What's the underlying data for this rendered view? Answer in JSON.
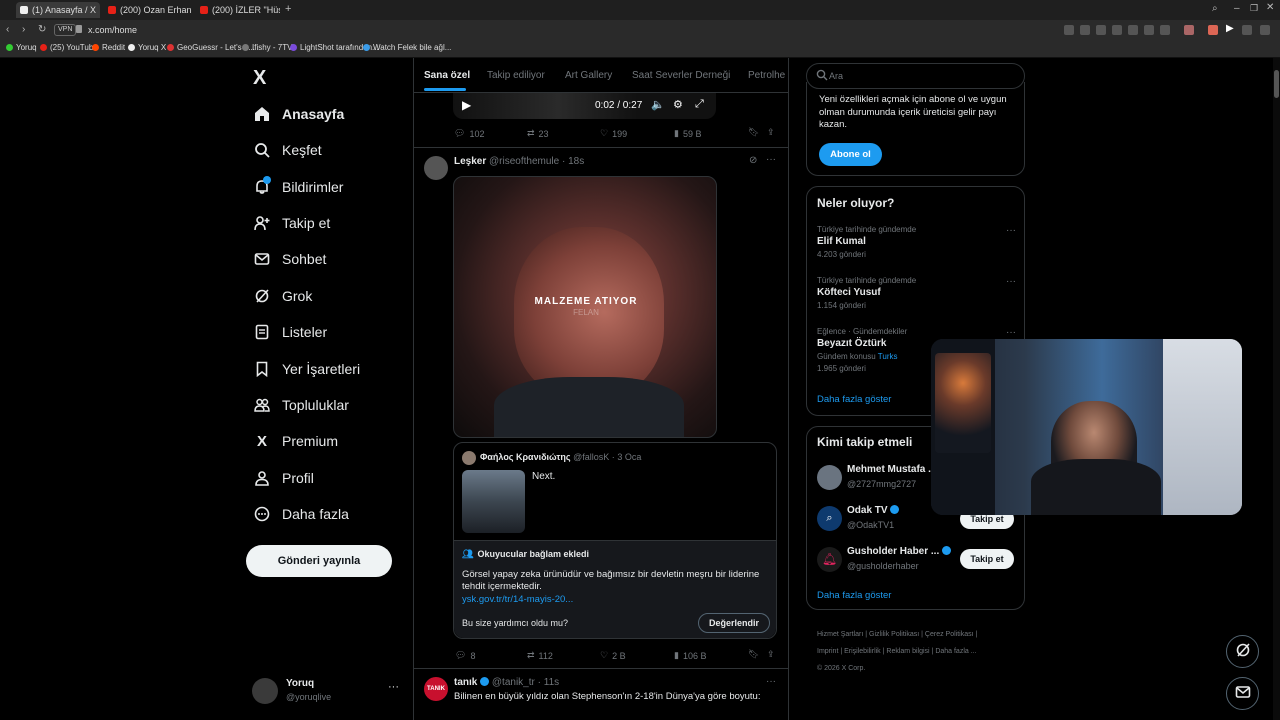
{
  "browser": {
    "tabs": [
      {
        "label": "(1) Anasayfa / X",
        "active": true
      },
      {
        "label": "(200) Ozan Erhan ÇERKEZ",
        "active": false
      },
      {
        "label": "(200) İZLER \"Hüseyin Nih",
        "active": false
      }
    ],
    "address": "x.com/home",
    "bookmarks": [
      "Yoruq",
      "(25) YouTube",
      "Reddit",
      "Yoruq X",
      "GeoGuessr - Let's e...",
      "Ifishy - 7TV",
      "LightShot tarafından...",
      "Watch Felek bile ağl..."
    ]
  },
  "sidebar": {
    "logo": "X",
    "items": [
      {
        "label": "Anasayfa",
        "icon": "home-icon"
      },
      {
        "label": "Keşfet",
        "icon": "search-icon"
      },
      {
        "label": "Bildirimler",
        "icon": "bell-icon"
      },
      {
        "label": "Takip et",
        "icon": "add-user-icon"
      },
      {
        "label": "Sohbet",
        "icon": "mail-icon"
      },
      {
        "label": "Grok",
        "icon": "grok-icon"
      },
      {
        "label": "Listeler",
        "icon": "list-icon"
      },
      {
        "label": "Yer İşaretleri",
        "icon": "bookmark-icon"
      },
      {
        "label": "Topluluklar",
        "icon": "people-icon"
      },
      {
        "label": "Premium",
        "icon": "x-icon"
      },
      {
        "label": "Profil",
        "icon": "person-icon"
      },
      {
        "label": "Daha fazla",
        "icon": "more-circle-icon"
      }
    ],
    "post_button": "Gönderi yayınla",
    "account": {
      "name": "Yoruq",
      "handle": "@yoruqlive"
    }
  },
  "feed": {
    "tabs": [
      "Sana özel",
      "Takip ediliyor",
      "Art Gallery",
      "Saat Severler Derneği",
      "Petrolhe"
    ],
    "prev_post": {
      "time": "0:02 / 0:27",
      "replies": "102",
      "reposts": "23",
      "likes": "199",
      "views": "59 B"
    },
    "post": {
      "name": "Leşker",
      "handle": "@riseofthemule",
      "time": "18s",
      "video_caption": "MALZEME ATIYOR",
      "video_sub": "FELAN",
      "quote": {
        "name": "Φαήλος Κρανιδιώτης",
        "handle": "@fallosK",
        "time": "3 Oca",
        "text": "Next."
      },
      "note": {
        "title": "Okuyucular bağlam ekledi",
        "text": "Görsel yapay zeka ürünüdür ve bağımsız bir devletin meşru bir liderine tehdit içermektedir.",
        "link": "ysk.gov.tr/tr/14-mayis-20...",
        "question": "Bu size yardımcı oldu mu?",
        "rate": "Değerlendir"
      },
      "replies": "8",
      "reposts": "112",
      "likes": "2 B",
      "views": "106 B"
    },
    "next_post": {
      "avatar_text": "TANIK",
      "name": "tanık",
      "handle": "@tanik_tr",
      "time": "11s",
      "text": "Bilinen en büyük yıldız olan Stephenson'ın 2-18'in Dünya'ya göre boyutu:"
    }
  },
  "right": {
    "search_placeholder": "Ara",
    "premium": {
      "text": "Yeni özellikleri açmak için abone ol ve uygun olman durumunda içerik üreticisi gelir payı kazan.",
      "button": "Abone ol"
    },
    "trends": {
      "title": "Neler oluyor?",
      "items": [
        {
          "meta": "Türkiye tarihinde gündemde",
          "title": "Elif Kumal",
          "count": "4.203 gönderi"
        },
        {
          "meta": "Türkiye tarihinde gündemde",
          "title": "Köfteci Yusuf",
          "count": "1.154 gönderi"
        },
        {
          "meta": "Eğlence · Gündemdekiler",
          "title": "Beyazıt Öztürk",
          "topic_label": "Gündem konusu",
          "topic": "Turks",
          "count": "1.965 gönderi"
        }
      ],
      "more": "Daha fazla göster"
    },
    "who_to_follow": {
      "title": "Kimi takip etmeli",
      "items": [
        {
          "name": "Mehmet Mustafa ...",
          "handle": "@2727mmg2727",
          "button": ""
        },
        {
          "name": "Odak TV",
          "handle": "@OdakTV1",
          "button": "Takip et"
        },
        {
          "name": "Gusholder Haber ...",
          "handle": "@gusholderhaber",
          "button": "Takip et"
        }
      ],
      "more": "Daha fazla göster"
    },
    "footer": [
      "Hizmet Şartları",
      "Gizlilik Politikası",
      "Çerez Politikası",
      "Imprint",
      "Erişilebilirlik",
      "Reklam bilgisi",
      "Daha fazla ...",
      "© 2026 X Corp."
    ]
  },
  "colors": {
    "accent": "#1d9bf0",
    "bg": "#000000",
    "border": "#2f3336",
    "muted": "#71767b"
  }
}
